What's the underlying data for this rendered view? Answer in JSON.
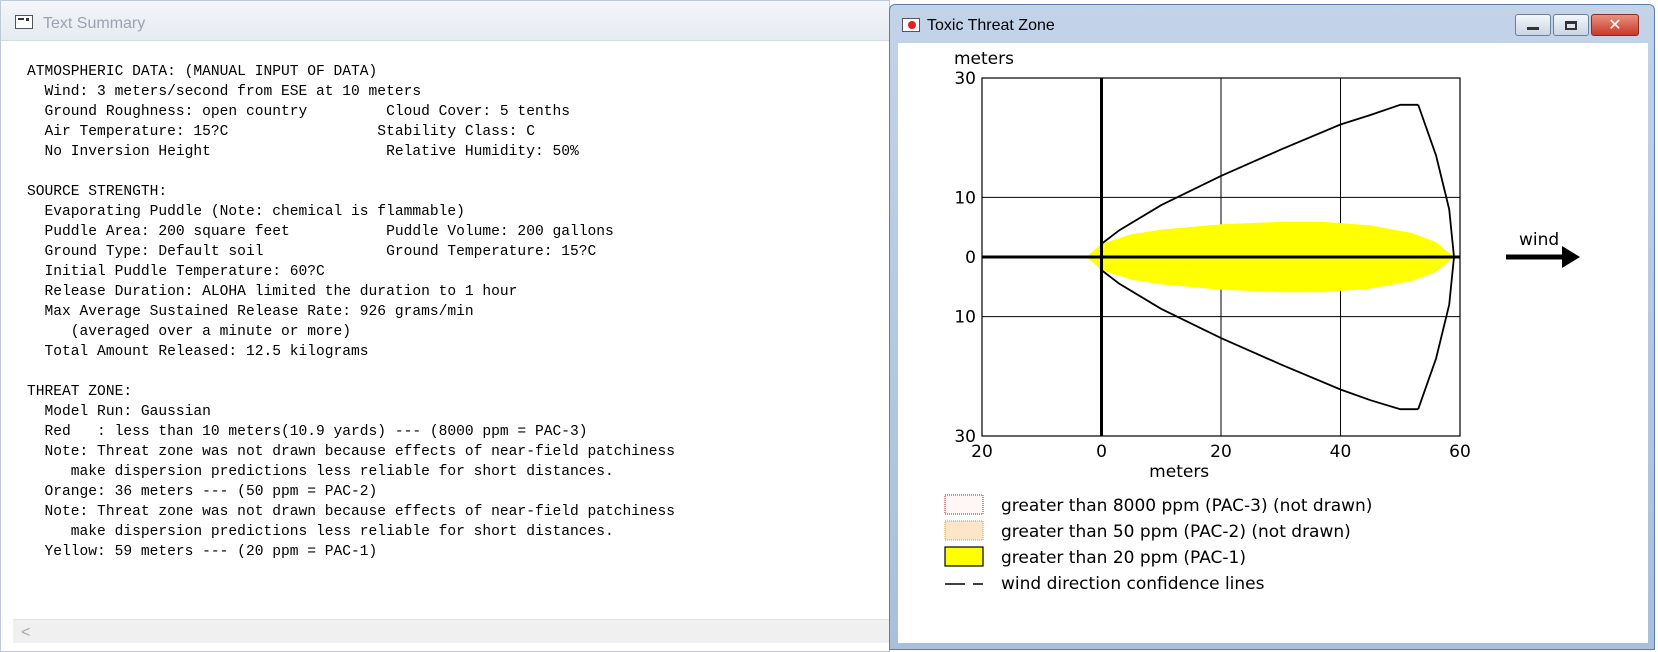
{
  "left_window": {
    "title": "Text Summary",
    "summary_lines": [
      "ATMOSPHERIC DATA: (MANUAL INPUT OF DATA)",
      "  Wind: 3 meters/second from ESE at 10 meters",
      "  Ground Roughness: open country         Cloud Cover: 5 tenths",
      "  Air Temperature: 15?C                 Stability Class: C",
      "  No Inversion Height                    Relative Humidity: 50%",
      "",
      "SOURCE STRENGTH:",
      "  Evaporating Puddle (Note: chemical is flammable)",
      "  Puddle Area: 200 square feet           Puddle Volume: 200 gallons",
      "  Ground Type: Default soil              Ground Temperature: 15?C",
      "  Initial Puddle Temperature: 60?C",
      "  Release Duration: ALOHA limited the duration to 1 hour",
      "  Max Average Sustained Release Rate: 926 grams/min",
      "     (averaged over a minute or more)",
      "  Total Amount Released: 12.5 kilograms",
      "",
      "THREAT ZONE:",
      "  Model Run: Gaussian",
      "  Red   : less than 10 meters(10.9 yards) --- (8000 ppm = PAC-3)",
      "  Note: Threat zone was not drawn because effects of near-field patchiness",
      "     make dispersion predictions less reliable for short distances.",
      "  Orange: 36 meters --- (50 ppm = PAC-2)",
      "  Note: Threat zone was not drawn because effects of near-field patchiness",
      "     make dispersion predictions less reliable for short distances.",
      "  Yellow: 59 meters --- (20 ppm = PAC-1)"
    ],
    "scroll_arrow": "<"
  },
  "right_window": {
    "title": "Toxic Threat Zone",
    "buttons": {
      "minimize": "",
      "maximize": "",
      "close": "✕"
    },
    "colors": {
      "yellow_zone": "#ffff00",
      "red_zone": "#e03a3a",
      "orange_zone": "#f0a050"
    },
    "icons": [
      "threat-zone-app-icon",
      "minimize-icon",
      "maximize-icon",
      "close-icon",
      "wind-arrow-icon"
    ]
  },
  "chart_data": {
    "type": "area",
    "ylabel": "meters",
    "xlabel": "meters",
    "xlim": [
      -20,
      60
    ],
    "ylim": [
      -30,
      30
    ],
    "x_ticks": [
      {
        "value": -20,
        "label": "20"
      },
      {
        "value": 0,
        "label": "0"
      },
      {
        "value": 20,
        "label": "20"
      },
      {
        "value": 40,
        "label": "40"
      },
      {
        "value": 60,
        "label": "60"
      }
    ],
    "y_ticks": [
      {
        "value": 30,
        "label": "30"
      },
      {
        "value": 10,
        "label": "10"
      },
      {
        "value": 0,
        "label": "0"
      },
      {
        "value": -10,
        "label": "10"
      },
      {
        "value": -30,
        "label": "30"
      }
    ],
    "grid": true,
    "wind_label": "wind",
    "yellow_zone": {
      "x_start": -2.5,
      "x_end": 59,
      "points": [
        [
          -2.5,
          0
        ],
        [
          0,
          2.2
        ],
        [
          5,
          3.8
        ],
        [
          10,
          4.6
        ],
        [
          20,
          5.5
        ],
        [
          30,
          5.9
        ],
        [
          37,
          5.9
        ],
        [
          45,
          5.3
        ],
        [
          52,
          4.0
        ],
        [
          56,
          2.5
        ],
        [
          59,
          0
        ],
        [
          56,
          -2.5
        ],
        [
          52,
          -4.0
        ],
        [
          45,
          -5.3
        ],
        [
          37,
          -5.9
        ],
        [
          30,
          -5.9
        ],
        [
          20,
          -5.5
        ],
        [
          10,
          -4.6
        ],
        [
          5,
          -3.8
        ],
        [
          0,
          -2.2
        ]
      ]
    },
    "confidence_lines": {
      "upper": [
        [
          0,
          2.2
        ],
        [
          3,
          4.5
        ],
        [
          10,
          8.7
        ],
        [
          20,
          13.6
        ],
        [
          30,
          18.0
        ],
        [
          40,
          22.2
        ],
        [
          45,
          23.8
        ],
        [
          50,
          25.5
        ],
        [
          53,
          25.5
        ]
      ],
      "lower": [
        [
          0,
          -2.2
        ],
        [
          3,
          -4.5
        ],
        [
          10,
          -8.7
        ],
        [
          20,
          -13.6
        ],
        [
          30,
          -18.0
        ],
        [
          40,
          -22.2
        ],
        [
          45,
          -24.0
        ],
        [
          50,
          -25.5
        ],
        [
          53,
          -25.5
        ]
      ],
      "arc_end": [
        [
          53,
          25.5
        ],
        [
          56,
          17
        ],
        [
          58.2,
          8
        ],
        [
          59,
          0
        ],
        [
          58.2,
          -8
        ],
        [
          56,
          -17
        ],
        [
          53,
          -25.5
        ]
      ]
    },
    "legend": [
      {
        "label": "greater than 8000 ppm (PAC-3) (not drawn)",
        "swatch": "red-dotted"
      },
      {
        "label": "greater than 50 ppm (PAC-2) (not drawn)",
        "swatch": "orange-dotted"
      },
      {
        "label": "greater than 20 ppm (PAC-1)",
        "swatch": "yellow-solid"
      },
      {
        "label": "wind direction confidence lines",
        "swatch": "dashed-line"
      }
    ]
  }
}
